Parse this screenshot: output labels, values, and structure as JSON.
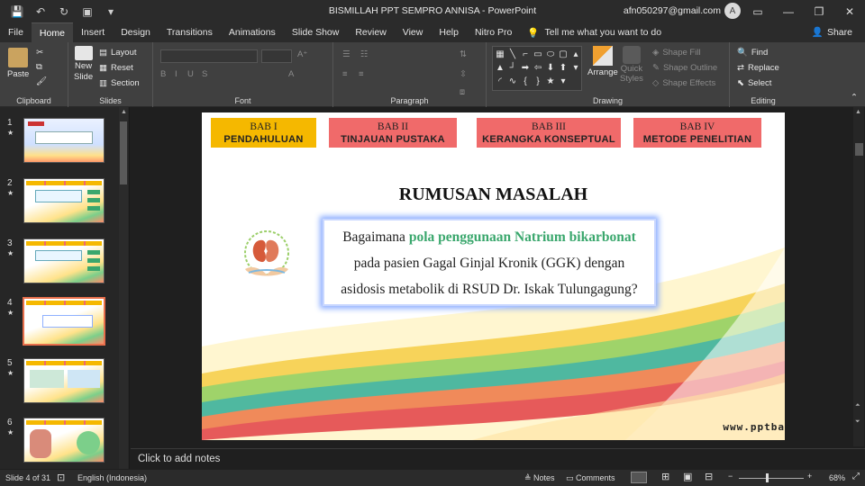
{
  "window": {
    "doc_title": "BISMILLAH PPT SEMPRO ANNISA  -  PowerPoint",
    "account": "afn050297@gmail.com",
    "avatar_initial": "A"
  },
  "tabs": [
    "File",
    "Home",
    "Insert",
    "Design",
    "Transitions",
    "Animations",
    "Slide Show",
    "Review",
    "View",
    "Help",
    "Nitro Pro"
  ],
  "active_tab": "Home",
  "tell_me": "Tell me what you want to do",
  "share": "Share",
  "ribbon": {
    "clipboard": {
      "label": "Clipboard",
      "paste": "Paste"
    },
    "slides": {
      "label": "Slides",
      "new_slide": "New",
      "new_slide2": "Slide",
      "layout": "Layout",
      "reset": "Reset",
      "section": "Section"
    },
    "font": {
      "label": "Font"
    },
    "paragraph": {
      "label": "Paragraph"
    },
    "drawing": {
      "label": "Drawing",
      "arrange": "Arrange",
      "quick_styles": "Quick",
      "quick_styles2": "Styles",
      "shape_fill": "Shape Fill",
      "shape_outline": "Shape Outline",
      "shape_effects": "Shape Effects"
    },
    "editing": {
      "label": "Editing",
      "find": "Find",
      "replace": "Replace",
      "select": "Select"
    }
  },
  "thumbnails": [
    {
      "num": "1"
    },
    {
      "num": "2"
    },
    {
      "num": "3"
    },
    {
      "num": "4",
      "selected": true
    },
    {
      "num": "5"
    },
    {
      "num": "6"
    }
  ],
  "slide": {
    "bab": [
      {
        "line1": "BAB I",
        "line2": "PENDAHULUAN",
        "color": "#f5b800"
      },
      {
        "line1": "BAB II",
        "line2": "TINJAUAN PUSTAKA",
        "color": "#f06a6a"
      },
      {
        "line1": "BAB III",
        "line2": "KERANGKA KONSEPTUAL",
        "color": "#f06a6a"
      },
      {
        "line1": "BAB IV",
        "line2": "METODE PENELITIAN",
        "color": "#f06a6a"
      }
    ],
    "title": "RUMUSAN MASALAH",
    "question": {
      "pre": "Bagaimana ",
      "highlight": "pola penggunaan Natrium bikarbonat",
      "line2": "pada pasien Gagal Ginjal Kronik (GGK) dengan",
      "line3": "asidosis metabolik di RSUD Dr. Iskak Tulungagung?"
    },
    "watermark": "www.pptba"
  },
  "notes_placeholder": "Click to add notes",
  "status": {
    "slide": "Slide 4 of 31",
    "language": "English (Indonesia)",
    "notes": "Notes",
    "comments": "Comments",
    "zoom": "68%"
  }
}
